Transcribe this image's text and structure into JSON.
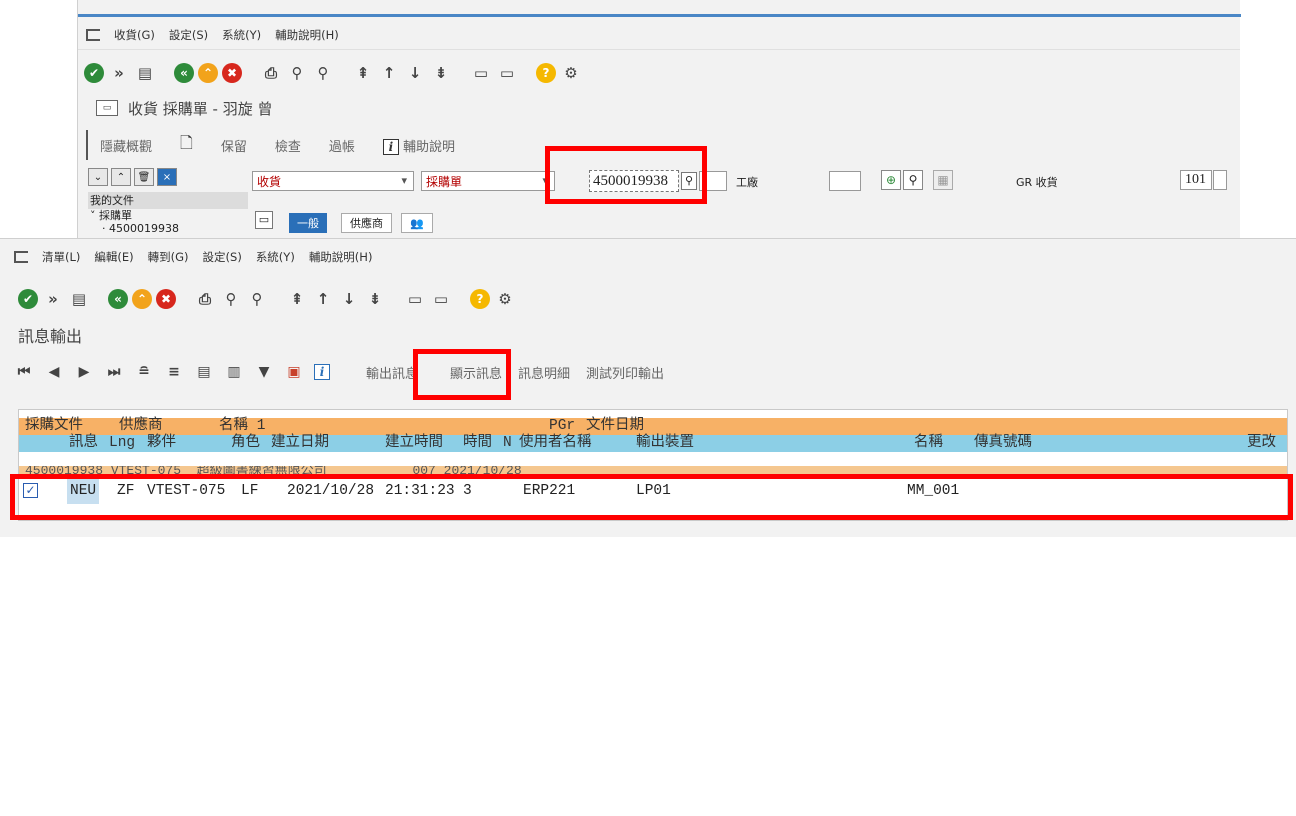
{
  "top_window": {
    "menu": [
      "收貨(G)",
      "設定(S)",
      "系統(Y)",
      "輔助說明(H)"
    ],
    "title": "收貨 採購單 - 羽旋 曾",
    "app_toolbar": [
      "隱藏概觀",
      "保留",
      "檢查",
      "過帳",
      "輔助說明"
    ],
    "tree": {
      "root": "我的文件",
      "node": "採購單",
      "leaf": "4500019938"
    },
    "transaction_value": "收貨",
    "reference_value": "採購單",
    "po_number": "4500019938",
    "plant_label": "工廠",
    "movement_label": "GR 收貨",
    "movement_type": "101",
    "tabs": [
      "一般",
      "供應商"
    ]
  },
  "bottom_window": {
    "menu": [
      "清單(L)",
      "編輯(E)",
      "轉到(G)",
      "設定(S)",
      "系統(Y)",
      "輔助說明(H)"
    ],
    "screen_title": "訊息輸出",
    "app_toolbar": [
      "輸出訊息",
      "顯示訊息",
      "訊息明細",
      "測試列印輸出"
    ],
    "header1": [
      "採購文件",
      "供應商",
      "名稱 1",
      "PGr",
      "文件日期"
    ],
    "header2": [
      "訊息",
      "Lng",
      "夥伴",
      "角色",
      "建立日期",
      "建立時間",
      "時間",
      "N",
      "使用者名稱",
      "輸出裝置",
      "名稱",
      "傳真號碼",
      "更改"
    ],
    "group_row": "4500019938 VTEST-075  超級圖書練習無限公司           007 2021/10/28",
    "row": {
      "checked": true,
      "message": "NEU",
      "lng": "ZF",
      "partner": "VTEST-075",
      "role": "LF",
      "date": "2021/10/28",
      "time": "21:31:23",
      "timing": "3",
      "user": "ERP221",
      "device": "LP01",
      "name": "MM_001"
    }
  },
  "colors": {
    "highlight": "#ff0000",
    "header1_bg": "#f7b166",
    "header2_bg": "#8ccfe6",
    "accent_blue": "#2a6fb8"
  }
}
